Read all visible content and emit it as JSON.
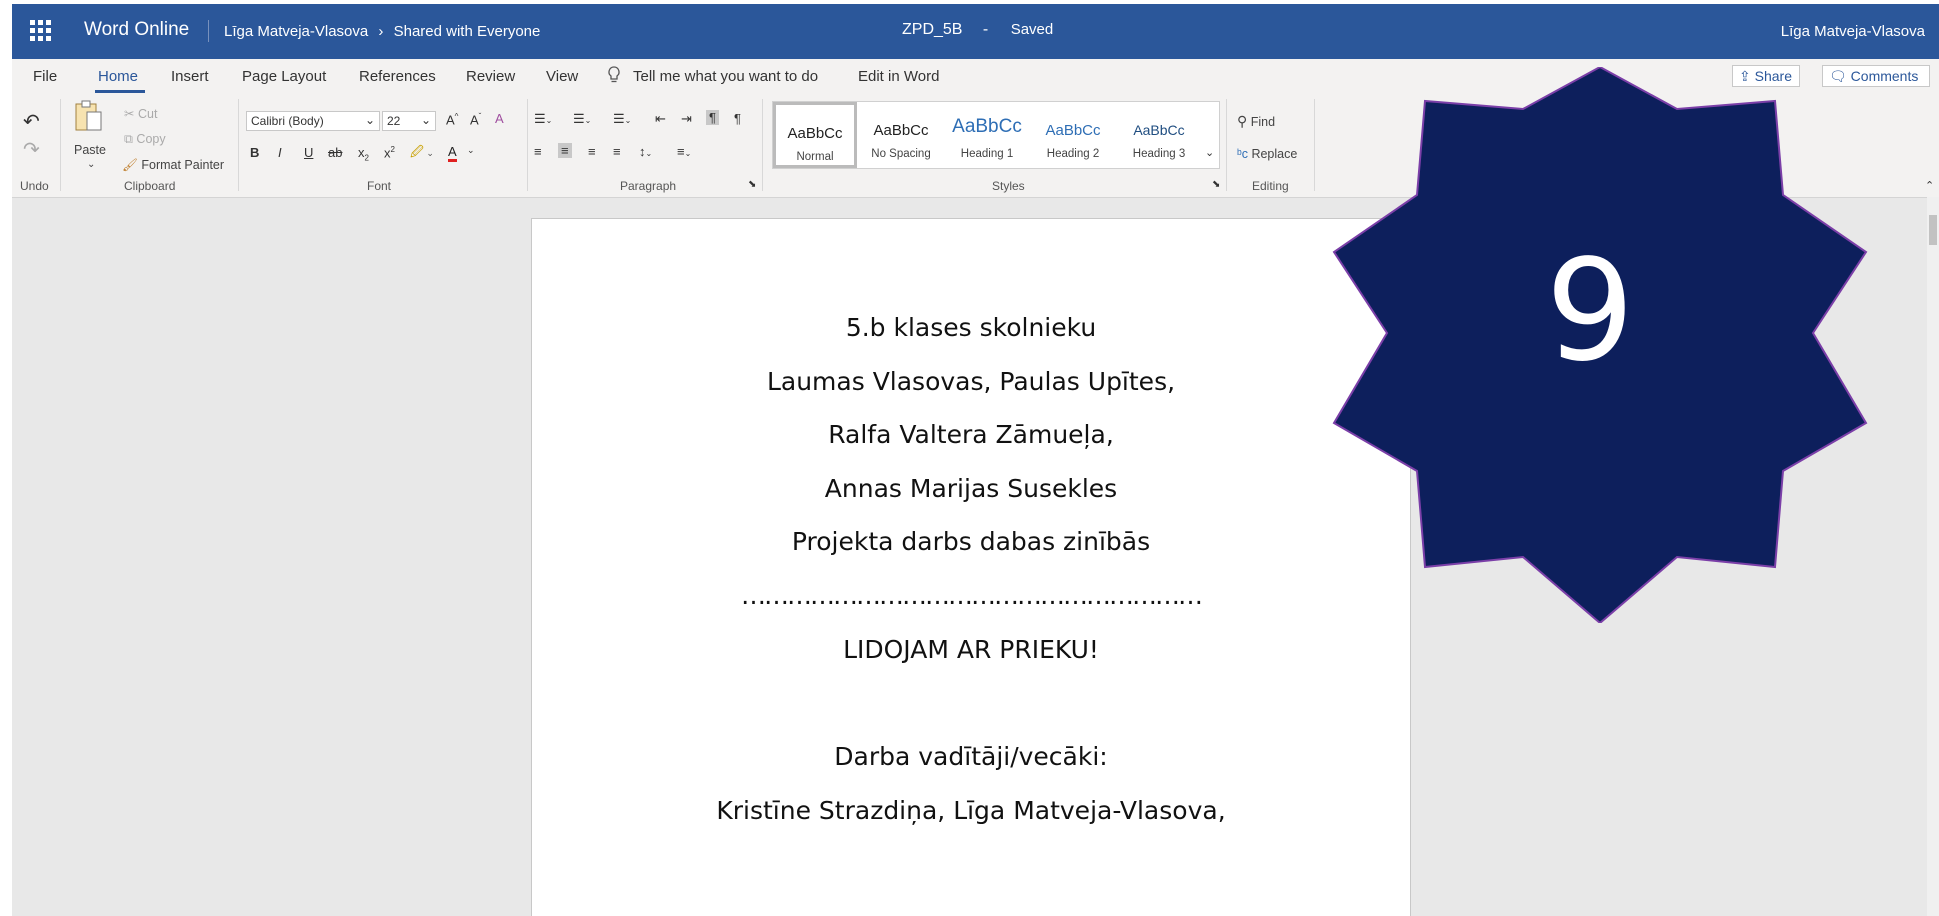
{
  "header": {
    "app_name": "Word Online",
    "owner": "Līga Matveja-Vlasova",
    "breadcrumb_sep": "›",
    "location": "Shared with Everyone",
    "doc_name": "ZPD_5B",
    "title_sep": "-",
    "save_status": "Saved",
    "user_name": "Līga Matveja-Vlasova",
    "color": "#2b579a"
  },
  "menu": {
    "file": "File",
    "home": "Home",
    "insert": "Insert",
    "page_layout": "Page Layout",
    "references": "References",
    "review": "Review",
    "view": "View",
    "tell_me": "Tell me what you want to do",
    "edit_in_word": "Edit in Word",
    "share": "Share",
    "comments": "Comments"
  },
  "ribbon": {
    "undo_group": "Undo",
    "clipboard": {
      "group": "Clipboard",
      "paste": "Paste",
      "cut": "Cut",
      "copy": "Copy",
      "format_painter": "Format Painter"
    },
    "font": {
      "group": "Font",
      "family": "Calibri (Body)",
      "size": "22"
    },
    "paragraph": {
      "group": "Paragraph"
    },
    "styles": {
      "group": "Styles",
      "items": [
        {
          "preview": "AaBbCc",
          "name": "Normal"
        },
        {
          "preview": "AaBbCc",
          "name": "No Spacing"
        },
        {
          "preview": "AaBbCc",
          "name": "Heading 1"
        },
        {
          "preview": "AaBbCc",
          "name": "Heading 2"
        },
        {
          "preview": "AaBbCc",
          "name": "Heading 3"
        }
      ]
    },
    "editing": {
      "group": "Editing",
      "find": "Find",
      "replace": "Replace"
    }
  },
  "document": {
    "lines": [
      "5.b klases skolnieku",
      "Laumas Vlasovas, Paulas Upītes,",
      "Ralfa Valtera Zāmueļa,",
      "Annas Marijas Susekles",
      "Projekta darbs dabas zinībās",
      "……………………………………………………",
      "LIDOJAM AR PRIEKU!",
      "Darba vadītāji/vecāki:",
      "Kristīne Strazdiņa, Līga Matveja-Vlasova,"
    ]
  },
  "overlay": {
    "number": "9",
    "fill": "#0d1f5c",
    "stroke": "#7b3fa8"
  }
}
